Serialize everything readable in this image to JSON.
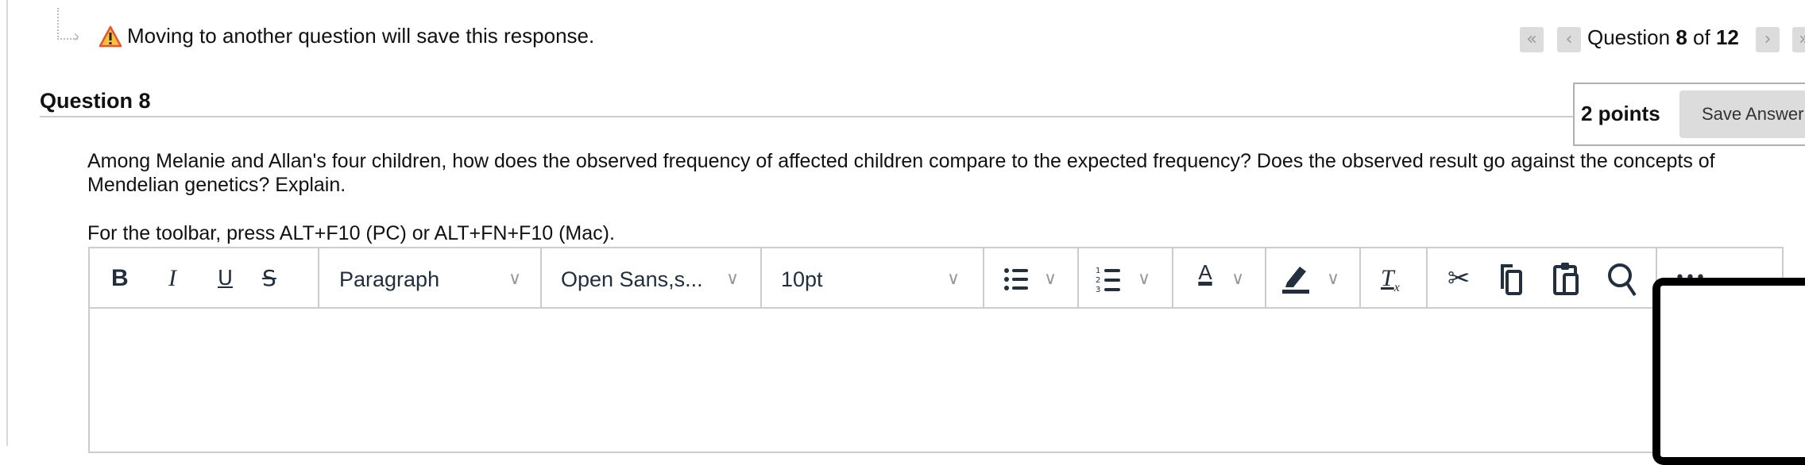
{
  "notice": {
    "text": "Moving to another question will save this response.",
    "icon": "warning-icon"
  },
  "nav": {
    "prefix": "Question",
    "current": "8",
    "of": "of",
    "total": "12",
    "first": "«",
    "prev": "‹",
    "next": "›",
    "last": "»"
  },
  "question": {
    "title": "Question 8",
    "points": "2 points",
    "save_label": "Save Answer",
    "text": "Among Melanie and Allan's four children, how does the observed frequency of affected children compare to the expected frequency? Does the observed result go against the concepts of Mendelian genetics? Explain."
  },
  "editor": {
    "hint": "For the toolbar, press ALT+F10 (PC) or ALT+FN+F10 (Mac).",
    "bold": "B",
    "italic": "I",
    "underline": "U",
    "strike": "S",
    "block_format": "Paragraph",
    "font_family": "Open Sans,s...",
    "font_size": "10pt",
    "text_color": "A",
    "clear_format": "T",
    "more": "•••",
    "value": ""
  },
  "colors": {
    "warning": "#f5a623",
    "icon": "#222f3e",
    "button_bg": "#dcdcdc"
  }
}
